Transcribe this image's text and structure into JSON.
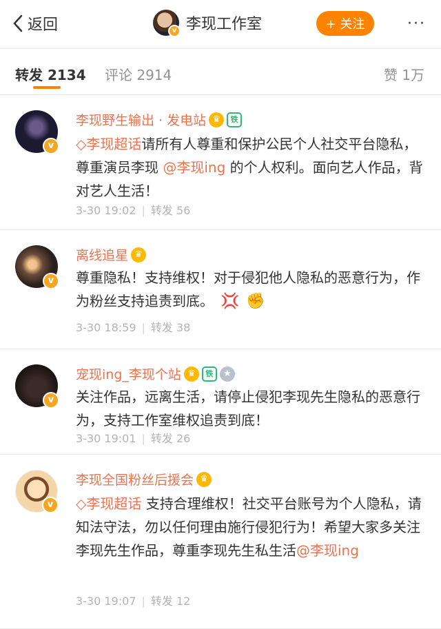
{
  "header": {
    "back_label": "返回",
    "title": "李现工作室",
    "follow_label": "+ 关注",
    "more_label": "···"
  },
  "tabs": {
    "repost": "转发 2134",
    "comment": "评论 2914",
    "like": "赞 1万"
  },
  "posts": [
    {
      "name": "李现野生输出 · 发电站",
      "segments": [
        {
          "text": "◇李现超话",
          "type": "topic"
        },
        {
          "text": "请所有人尊重和保护公民个人社交平台隐私，尊重演员李现 ",
          "type": "text"
        },
        {
          "text": "@李现ing",
          "type": "mention"
        },
        {
          "text": " 的个人权利。面向艺人作品，背对艺人生活！",
          "type": "text"
        }
      ],
      "time": "3-30 19:02",
      "repost": "转发 56"
    },
    {
      "name": "离线追星",
      "segments": [
        {
          "text": "尊重隐私！支持维权！对于侵犯他人隐私的恶意行为，作为粉丝支持追责到底。",
          "type": "text"
        }
      ],
      "emojis": [
        "💢",
        "✊"
      ],
      "time": "3-30 18:59",
      "repost": "转发 38"
    },
    {
      "name": "宠现ing_李现个站",
      "segments": [
        {
          "text": "关注作品，远离生活，请停止侵犯李现先生隐私的恶意行为，支持工作室维权追责到底！",
          "type": "text"
        }
      ],
      "time": "3-30 19:01",
      "repost": "转发 26"
    },
    {
      "name": "李现全国粉丝后援会",
      "segments": [
        {
          "text": "◇李现超话",
          "type": "topic"
        },
        {
          "text": "  支持合理维权！社交平台账号为个人隐私，请知法守法，勿以任何理由施行侵犯行为！希望大家多关注李现先生作品，尊重李现先生私生活",
          "type": "text"
        },
        {
          "text": "@李现ing",
          "type": "mention"
        }
      ],
      "time": "3-30 19:07",
      "repost": "转发 12"
    }
  ],
  "colors": {
    "accent": "#ff8200",
    "name": "#eb7350",
    "meta": "#b3b3b3"
  }
}
